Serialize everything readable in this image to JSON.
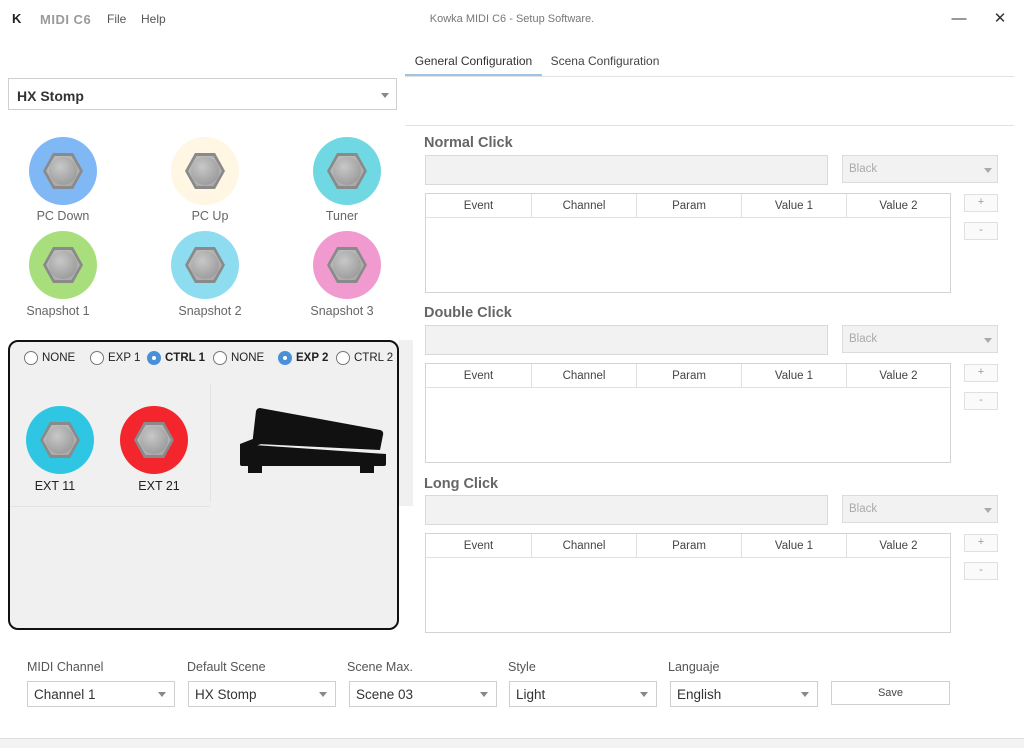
{
  "titlebar": {
    "logo": "K",
    "app_name": "MIDI C6",
    "menu": [
      "File",
      "Help"
    ],
    "window_title": "Kowka MIDI C6 - Setup Software.",
    "minimize": "—",
    "close": "✕"
  },
  "tabs": [
    {
      "label": "General Configuration",
      "active": true
    },
    {
      "label": "Scena Configuration",
      "active": false
    }
  ],
  "device_select": {
    "value": "HX Stomp"
  },
  "switches": [
    {
      "label": "PC Down",
      "color": "#7fb8f4"
    },
    {
      "label": "PC Up",
      "color": "#fff6e4"
    },
    {
      "label": "Tuner",
      "color": "#6fd8e2"
    },
    {
      "label": "Snapshot 1",
      "color": "#a9de7c"
    },
    {
      "label": "Snapshot 2",
      "color": "#8ddcef"
    },
    {
      "label": "Snapshot 3",
      "color": "#f19ad0"
    }
  ],
  "expression": {
    "radios": [
      {
        "label": "NONE",
        "checked": false
      },
      {
        "label": "EXP 1",
        "checked": false
      },
      {
        "label": "CTRL 1",
        "checked": true
      },
      {
        "label": "NONE",
        "checked": false
      },
      {
        "label": "EXP 2",
        "checked": true
      },
      {
        "label": "CTRL 2",
        "checked": false
      }
    ],
    "ext_switches": [
      {
        "label": "EXT 11",
        "color": "#2fc6e3"
      },
      {
        "label": "EXT 21",
        "color": "#f2262c"
      }
    ]
  },
  "click_sections": [
    {
      "title": "Normal Click",
      "color_value": "Black"
    },
    {
      "title": "Double Click",
      "color_value": "Black"
    },
    {
      "title": "Long Click",
      "color_value": "Black"
    }
  ],
  "table_columns": [
    "Event",
    "Channel",
    "Param",
    "Value 1",
    "Value 2"
  ],
  "row_buttons": {
    "add": "+",
    "remove": "-"
  },
  "footer": {
    "fields": [
      {
        "label": "MIDI Channel",
        "value": "Channel 1"
      },
      {
        "label": "Default Scene",
        "value": "HX Stomp"
      },
      {
        "label": "Scene Max.",
        "value": "Scene 03"
      },
      {
        "label": "Style",
        "value": "Light"
      },
      {
        "label": "Languaje",
        "value": "English"
      }
    ],
    "save_label": "Save"
  }
}
